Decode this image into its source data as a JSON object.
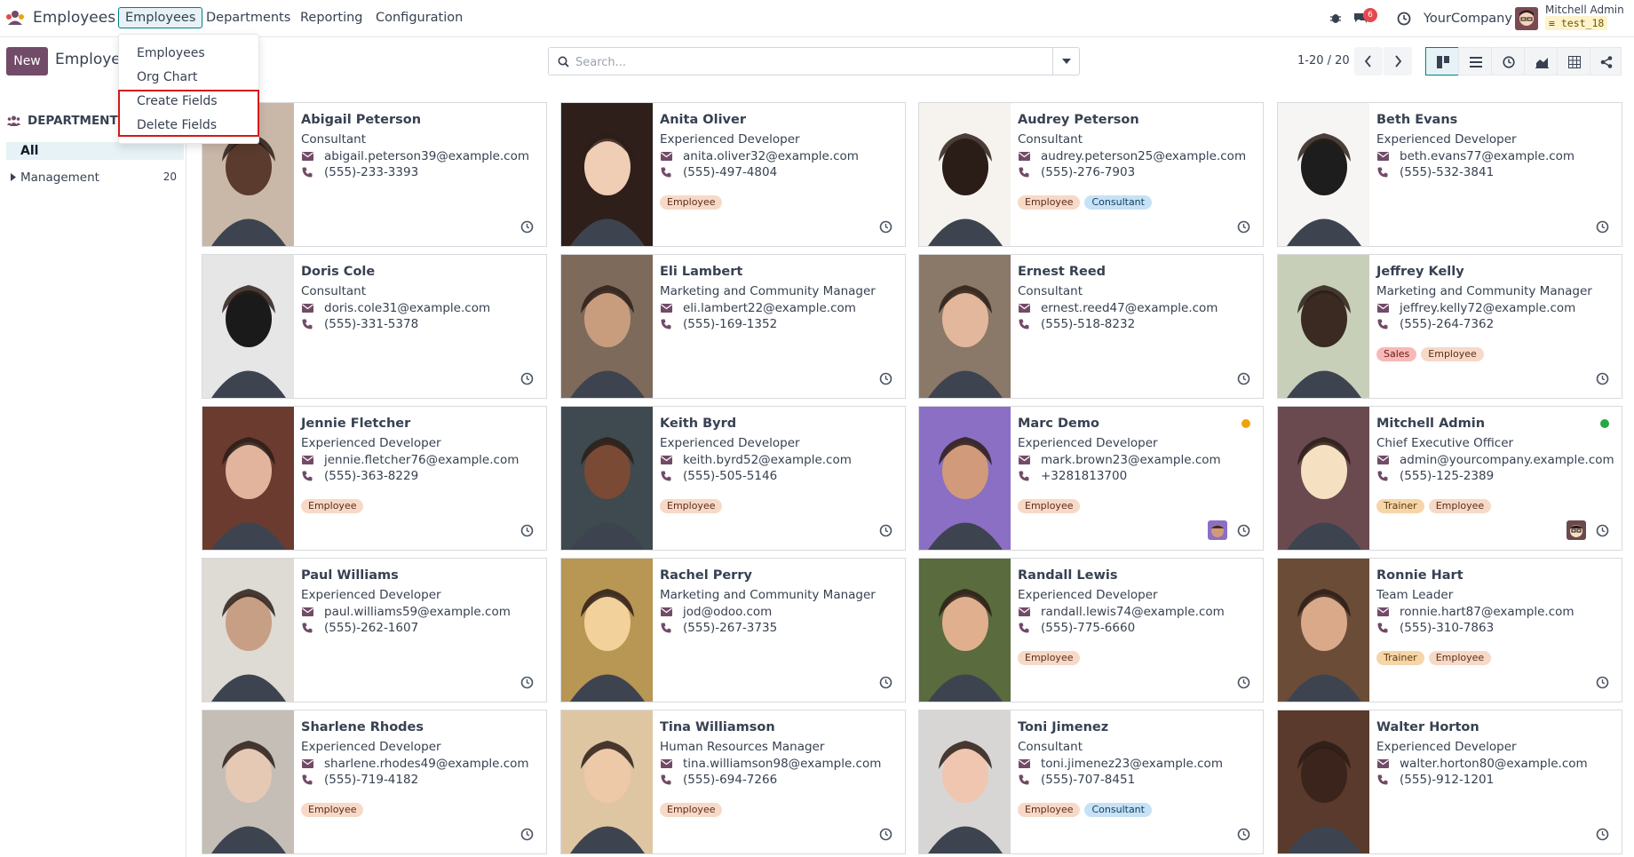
{
  "app": {
    "name": "Employees",
    "logo_icon": "odoo-people-icon"
  },
  "nav": {
    "menus": [
      "Employees",
      "Departments",
      "Reporting",
      "Configuration"
    ],
    "chat_badge": "6",
    "company": "YourCompany",
    "user_name": "Mitchell Admin",
    "db_name": "test_18"
  },
  "dropdown": {
    "items": [
      "Employees",
      "Org Chart",
      "Create Fields",
      "Delete Fields"
    ]
  },
  "control": {
    "new_label": "New",
    "breadcrumb": "Employees",
    "search_placeholder": "Search...",
    "pager": "1-20 / 20"
  },
  "sidebar": {
    "heading": "DEPARTMENT",
    "all_label": "All",
    "items": [
      {
        "label": "Management",
        "count": "20"
      }
    ]
  },
  "colors": {
    "brand": "#714b67",
    "accent": "#017e84",
    "online": "#28a745",
    "away": "#f0a30a"
  },
  "employees": [
    {
      "name": "Abigail Peterson",
      "job": "Consultant",
      "email": "abigail.peterson39@example.com",
      "phone": "(555)-233-3393",
      "tags": []
    },
    {
      "name": "Anita Oliver",
      "job": "Experienced Developer",
      "email": "anita.oliver32@example.com",
      "phone": "(555)-497-4804",
      "tags": [
        "Employee"
      ]
    },
    {
      "name": "Audrey Peterson",
      "job": "Consultant",
      "email": "audrey.peterson25@example.com",
      "phone": "(555)-276-7903",
      "tags": [
        "Employee",
        "Consultant"
      ]
    },
    {
      "name": "Beth Evans",
      "job": "Experienced Developer",
      "email": "beth.evans77@example.com",
      "phone": "(555)-532-3841",
      "tags": []
    },
    {
      "name": "Doris Cole",
      "job": "Consultant",
      "email": "doris.cole31@example.com",
      "phone": "(555)-331-5378",
      "tags": []
    },
    {
      "name": "Eli Lambert",
      "job": "Marketing and Community Manager",
      "email": "eli.lambert22@example.com",
      "phone": "(555)-169-1352",
      "tags": []
    },
    {
      "name": "Ernest Reed",
      "job": "Consultant",
      "email": "ernest.reed47@example.com",
      "phone": "(555)-518-8232",
      "tags": []
    },
    {
      "name": "Jeffrey Kelly",
      "job": "Marketing and Community Manager",
      "email": "jeffrey.kelly72@example.com",
      "phone": "(555)-264-7362",
      "tags": [
        "Sales",
        "Employee"
      ]
    },
    {
      "name": "Jennie Fletcher",
      "job": "Experienced Developer",
      "email": "jennie.fletcher76@example.com",
      "phone": "(555)-363-8229",
      "tags": [
        "Employee"
      ]
    },
    {
      "name": "Keith Byrd",
      "job": "Experienced Developer",
      "email": "keith.byrd52@example.com",
      "phone": "(555)-505-5146",
      "tags": [
        "Employee"
      ]
    },
    {
      "name": "Marc Demo",
      "job": "Experienced Developer",
      "email": "mark.brown23@example.com",
      "phone": "+3281813700",
      "tags": [
        "Employee"
      ]
    },
    {
      "name": "Mitchell Admin",
      "job": "Chief Executive Officer",
      "email": "admin@yourcompany.example.com",
      "phone": "(555)-125-2389",
      "tags": [
        "Trainer",
        "Employee"
      ]
    },
    {
      "name": "Paul Williams",
      "job": "Experienced Developer",
      "email": "paul.williams59@example.com",
      "phone": "(555)-262-1607",
      "tags": []
    },
    {
      "name": "Rachel Perry",
      "job": "Marketing and Community Manager",
      "email": "jod@odoo.com",
      "phone": "(555)-267-3735",
      "tags": []
    },
    {
      "name": "Randall Lewis",
      "job": "Experienced Developer",
      "email": "randall.lewis74@example.com",
      "phone": "(555)-775-6660",
      "tags": [
        "Employee"
      ]
    },
    {
      "name": "Ronnie Hart",
      "job": "Team Leader",
      "email": "ronnie.hart87@example.com",
      "phone": "(555)-310-7863",
      "tags": [
        "Trainer",
        "Employee"
      ]
    },
    {
      "name": "Sharlene Rhodes",
      "job": "Experienced Developer",
      "email": "sharlene.rhodes49@example.com",
      "phone": "(555)-719-4182",
      "tags": [
        "Employee"
      ]
    },
    {
      "name": "Tina Williamson",
      "job": "Human Resources Manager",
      "email": "tina.williamson98@example.com",
      "phone": "(555)-694-7266",
      "tags": [
        "Employee"
      ]
    },
    {
      "name": "Toni Jimenez",
      "job": "Consultant",
      "email": "toni.jimenez23@example.com",
      "phone": "(555)-707-8451",
      "tags": [
        "Employee",
        "Consultant"
      ]
    },
    {
      "name": "Walter Horton",
      "job": "Experienced Developer",
      "email": "walter.horton80@example.com",
      "phone": "(555)-912-1201",
      "tags": []
    }
  ]
}
